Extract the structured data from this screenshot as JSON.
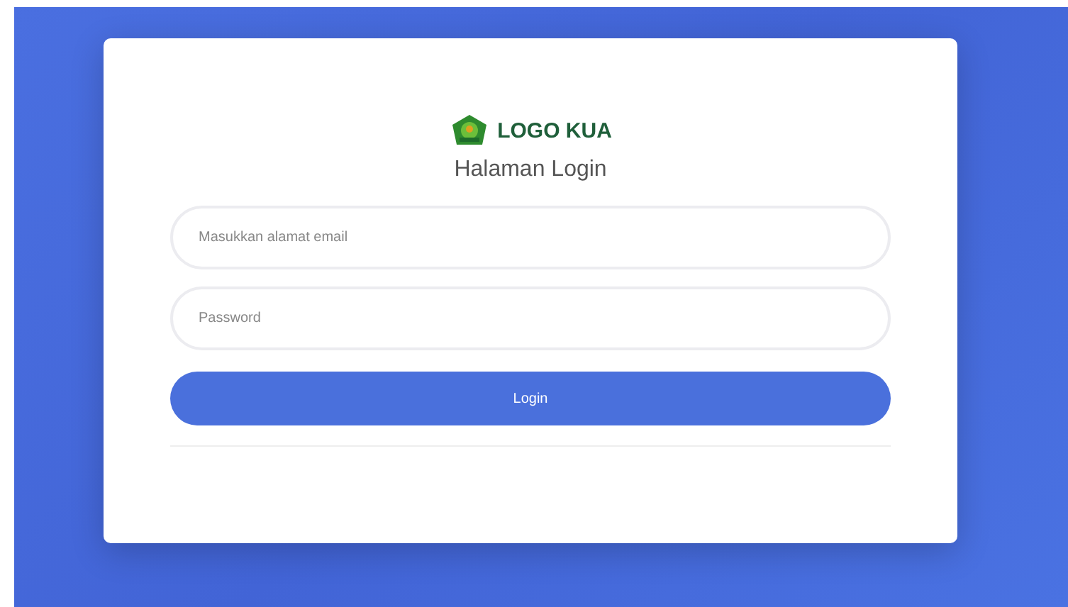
{
  "logo": {
    "text": "LOGO KUA"
  },
  "title": "Halaman Login",
  "fields": [
    {
      "placeholder": "Masukkan alamat email"
    },
    {
      "placeholder": "Password"
    }
  ],
  "button": {
    "label": "Login"
  }
}
